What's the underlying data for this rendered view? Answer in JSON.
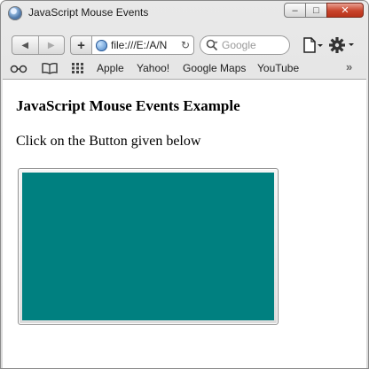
{
  "window": {
    "title": "JavaScript Mouse Events",
    "minimize_glyph": "–",
    "maximize_glyph": "□",
    "close_glyph": "✕"
  },
  "toolbar": {
    "back_glyph": "◀",
    "forward_glyph": "▶",
    "add_glyph": "+",
    "url": "file:///E:/A/N",
    "reload_glyph": "↻",
    "search_placeholder": "Google"
  },
  "bookmarks": {
    "items": [
      "Apple",
      "Yahoo!",
      "Google Maps",
      "YouTube"
    ],
    "more_glyph": "»"
  },
  "page": {
    "heading": "JavaScript Mouse Events Example",
    "instruction": "Click on the Button given below",
    "button_color": "#008080"
  },
  "icons": [
    "app-globe-icon",
    "globe-icon",
    "search-icon",
    "page-icon",
    "gear-icon",
    "reading-glasses-icon",
    "open-book-icon",
    "grid-icon"
  ]
}
